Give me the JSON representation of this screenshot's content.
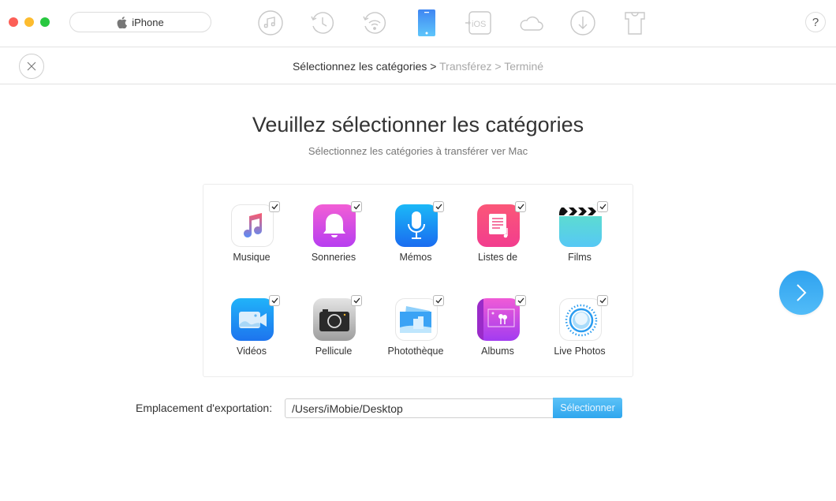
{
  "window": {
    "traffic_lights": [
      "close",
      "minimize",
      "zoom"
    ],
    "device_selector": {
      "label": "iPhone",
      "icon": "apple-icon"
    },
    "toolbar": [
      {
        "name": "music",
        "icon": "music-note-icon",
        "active": false
      },
      {
        "name": "backup",
        "icon": "history-icon",
        "active": false
      },
      {
        "name": "wifi-sync",
        "icon": "wifi-restore-icon",
        "active": false
      },
      {
        "name": "device",
        "icon": "phone-icon",
        "active": true
      },
      {
        "name": "to-ios",
        "icon": "to-ios-icon",
        "active": false
      },
      {
        "name": "icloud",
        "icon": "cloud-icon",
        "active": false
      },
      {
        "name": "download",
        "icon": "download-icon",
        "active": false
      },
      {
        "name": "skins",
        "icon": "tshirt-icon",
        "active": false
      }
    ],
    "help_label": "?",
    "accent_color": "#3aa9f2"
  },
  "steps": {
    "active": "Sélectionnez les catégories",
    "separator": ">",
    "step2": "Transférez",
    "step3": "Terminé"
  },
  "main": {
    "title": "Veuillez sélectionner les catégories",
    "subtitle": "Sélectionnez les catégories à transférer ver Mac",
    "categories": [
      {
        "label": "Musique",
        "icon": "music-icon",
        "checked": true
      },
      {
        "label": "Sonneries",
        "icon": "bell-icon",
        "checked": true
      },
      {
        "label": "Mémos",
        "icon": "microphone-icon",
        "checked": true
      },
      {
        "label": "Listes de",
        "icon": "playlist-icon",
        "checked": true
      },
      {
        "label": "Films",
        "icon": "clapperboard-icon",
        "checked": true
      },
      {
        "label": "Vidéos",
        "icon": "video-camera-icon",
        "checked": true
      },
      {
        "label": "Pellicule",
        "icon": "camera-icon",
        "checked": true
      },
      {
        "label": "Photothèque",
        "icon": "photo-library-icon",
        "checked": true
      },
      {
        "label": "Albums",
        "icon": "album-icon",
        "checked": true
      },
      {
        "label": "Live Photos",
        "icon": "live-photos-icon",
        "checked": true
      }
    ]
  },
  "export": {
    "label": "Emplacement d'exportation:",
    "path": "/Users/iMobie/Desktop",
    "button_label": "Sélectionner"
  }
}
